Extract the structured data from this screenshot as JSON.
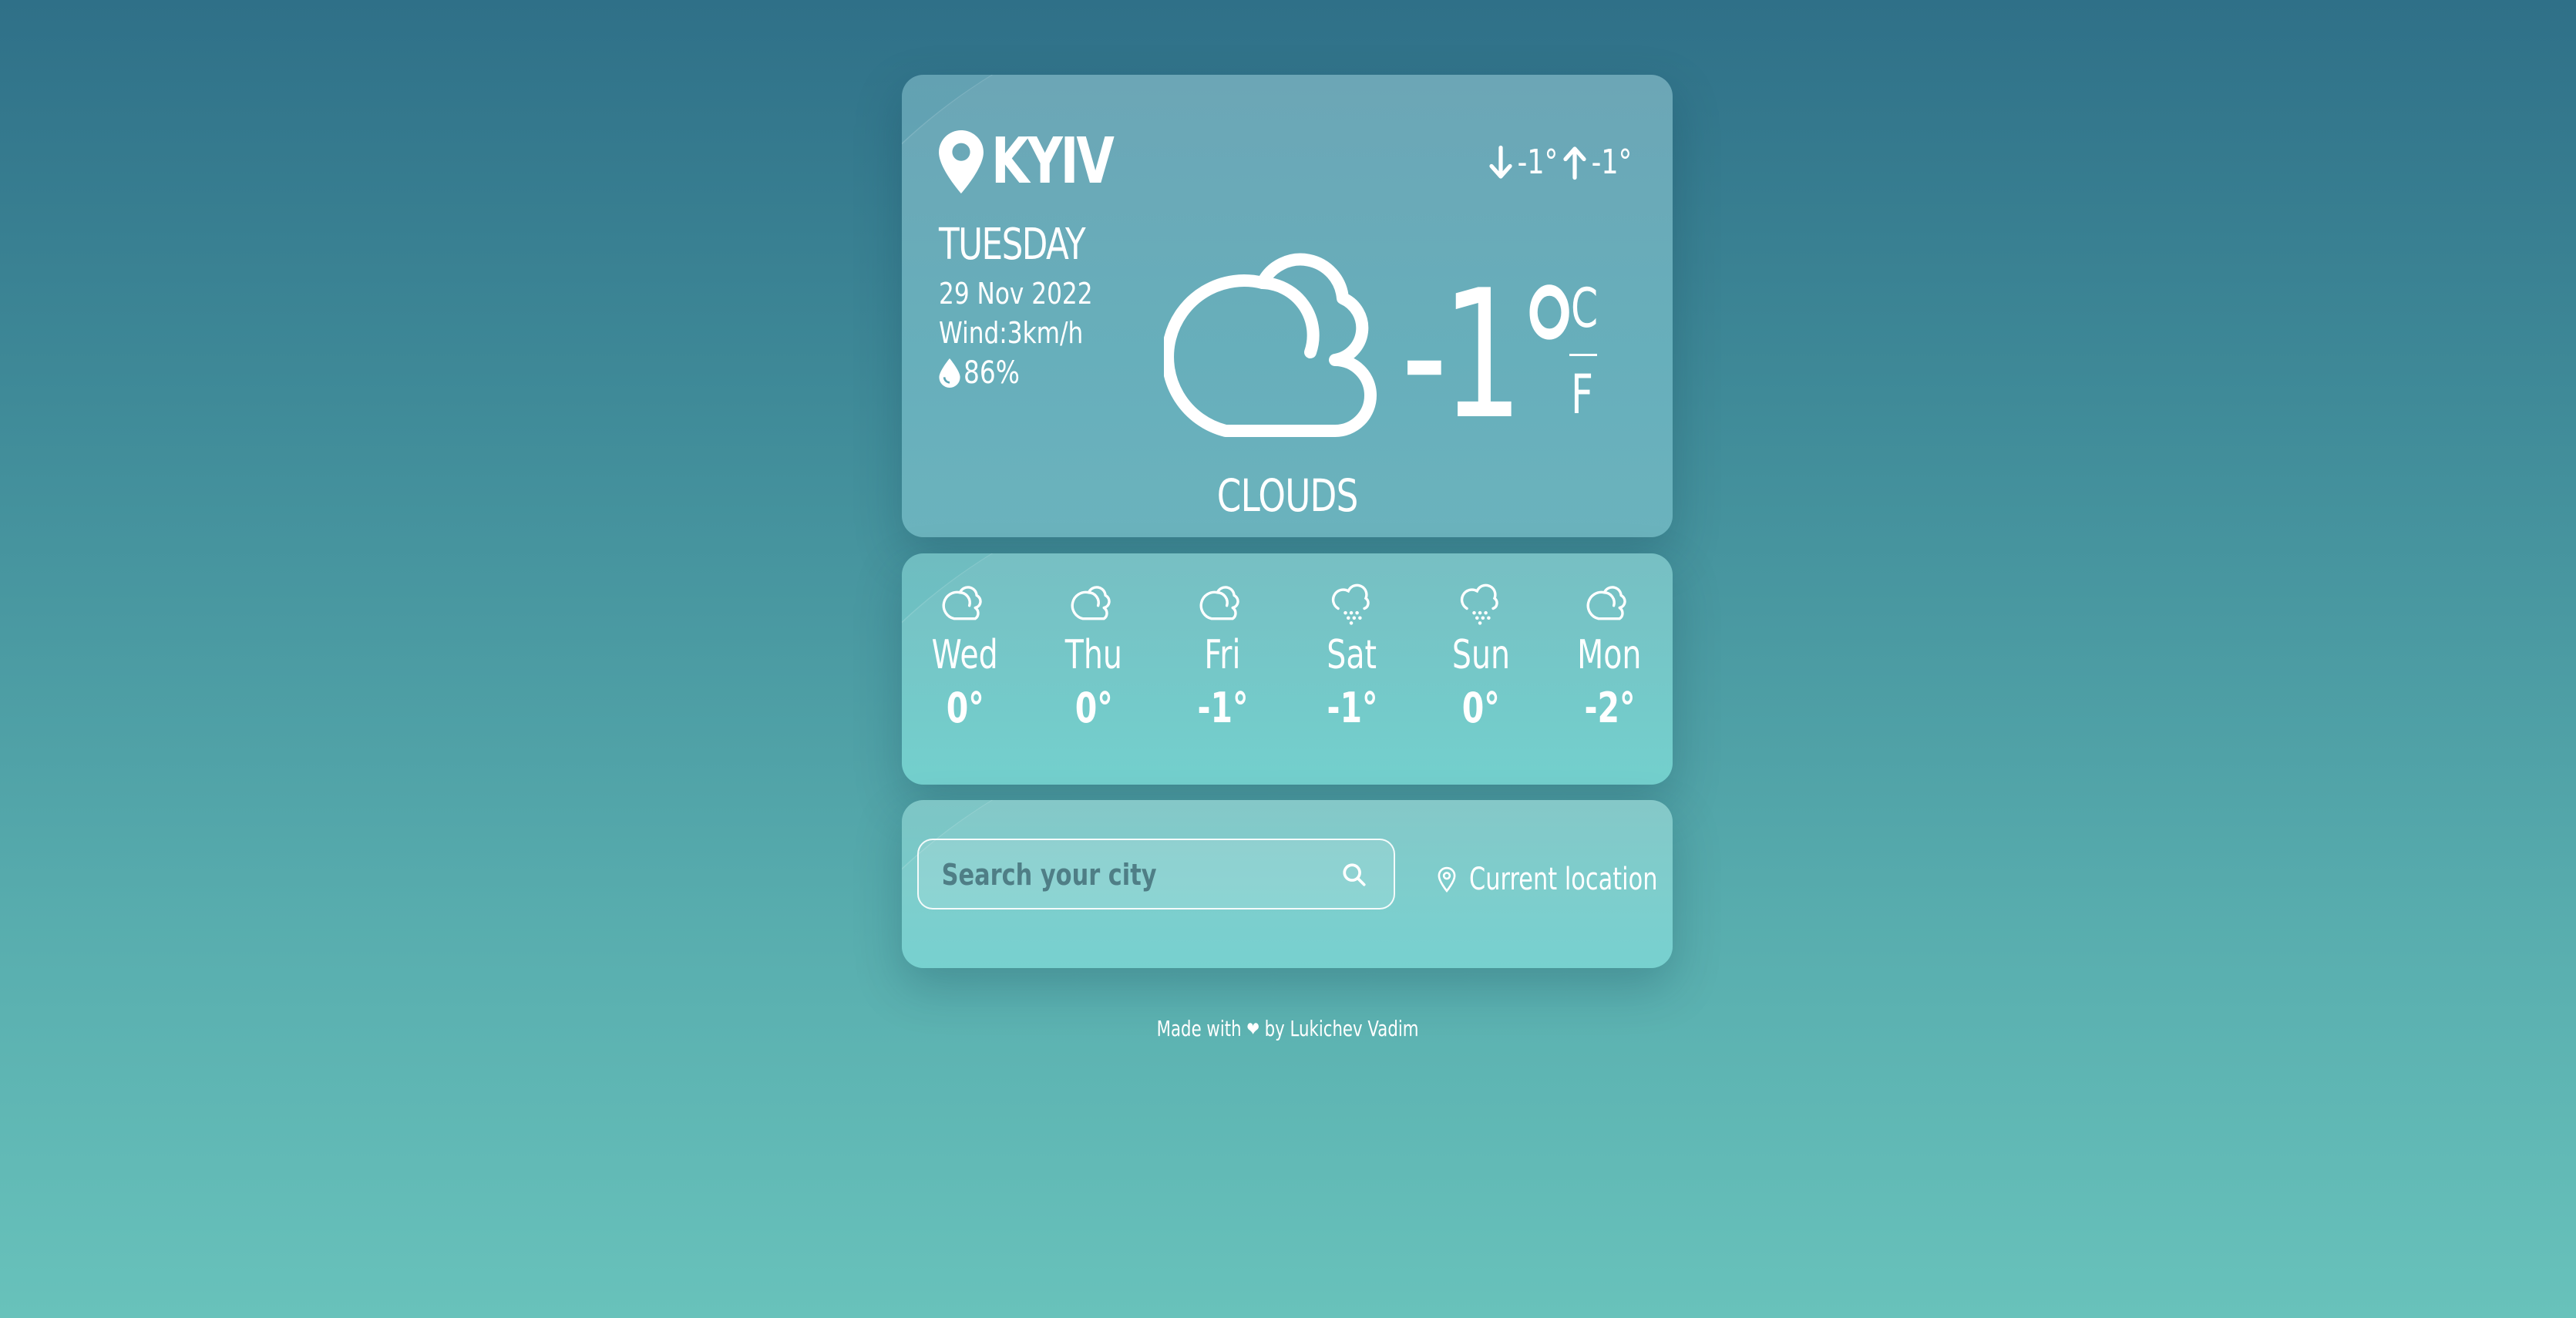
{
  "current": {
    "city": "KYIV",
    "day": "TUESDAY",
    "date": "29 Nov 2022",
    "wind": "Wind:3km/h",
    "humidity": "86%",
    "temp_min": "-1°",
    "temp_max": "-1°",
    "temperature": "-1°",
    "unit_celsius": "C",
    "unit_fahrenheit": "F",
    "condition": "CLOUDS",
    "condition_icon": "cloud-icon"
  },
  "forecast": [
    {
      "day": "Wed",
      "temp": "0°",
      "icon": "cloud-icon"
    },
    {
      "day": "Thu",
      "temp": "0°",
      "icon": "cloud-icon"
    },
    {
      "day": "Fri",
      "temp": "-1°",
      "icon": "cloud-icon"
    },
    {
      "day": "Sat",
      "temp": "-1°",
      "icon": "snow-icon"
    },
    {
      "day": "Sun",
      "temp": "0°",
      "icon": "snow-icon"
    },
    {
      "day": "Mon",
      "temp": "-2°",
      "icon": "cloud-icon"
    }
  ],
  "search": {
    "placeholder": "Search your city",
    "value": "",
    "location_label": "Current location"
  },
  "footer": {
    "made_with": "Made with",
    "by": "by Lukichev Vadim"
  },
  "colors": {
    "background_top": "#2f7088",
    "background_bottom": "#68c2bb",
    "text": "#ffffff"
  }
}
